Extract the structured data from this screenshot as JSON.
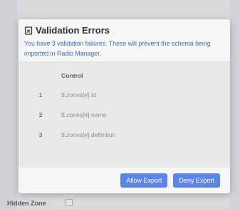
{
  "background": {
    "hidden_zone_label": "Hidden Zone"
  },
  "modal": {
    "title": "Validation Errors",
    "title_icon": "document-x-icon",
    "description": "You have 3 validation failures. These will prevent the schema being imported in Radio Manager.",
    "table": {
      "headers": [
        "",
        "Control"
      ],
      "rows": [
        {
          "index": "1",
          "control": "$.zones[#].id"
        },
        {
          "index": "2",
          "control": "$.zones[#].name"
        },
        {
          "index": "3",
          "control": "$.zones[#].definition"
        }
      ]
    },
    "buttons": {
      "allow_export": "Allow Export",
      "deny_export": "Deny Export"
    }
  },
  "colors": {
    "accent": "#5b84e3",
    "description_text": "#3f6fb6"
  }
}
